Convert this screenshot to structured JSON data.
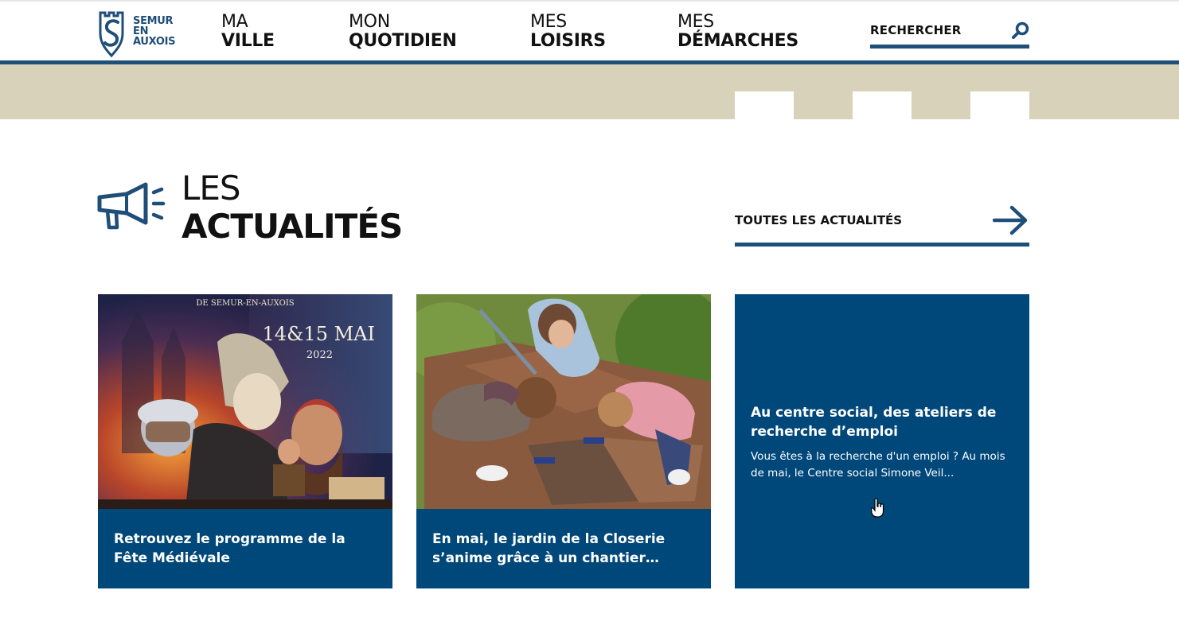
{
  "logo": {
    "line1": "SEMUR",
    "line2": "EN",
    "line3": "AUXOIS",
    "icon": "castle-shield-icon"
  },
  "nav": [
    {
      "top": "MA",
      "bottom": "VILLE"
    },
    {
      "top": "MON",
      "bottom": "QUOTIDIEN"
    },
    {
      "top": "MES",
      "bottom": "LOISIRS"
    },
    {
      "top": "MES",
      "bottom": "DÉMARCHES"
    }
  ],
  "search": {
    "label": "RECHERCHER",
    "icon": "search-icon"
  },
  "news": {
    "title_line1": "LES",
    "title_line2": "ACTUALITÉS",
    "icon": "megaphone-icon",
    "all_link": "TOUTES LES ACTUALITÉS",
    "all_link_icon": "arrow-right-icon",
    "cards": [
      {
        "title": "Retrouvez le programme de la Fête Médiévale",
        "image": {
          "icon": "medieval-festival-poster-image",
          "text_line1": "DE SEMUR-EN-AUXOIS",
          "text_line2": "14&15 MAI",
          "text_line3": "2022"
        }
      },
      {
        "title": "En mai, le jardin de la Closerie s’anime grâce à un chantier…",
        "image": {
          "icon": "garden-children-photo"
        }
      },
      {
        "title": "Au centre social, des ateliers de recherche d’emploi",
        "excerpt": "Vous êtes à la recherche d'un emploi ? Au mois de mai, le Centre social Simone Veil..."
      }
    ]
  },
  "colors": {
    "primary": "#1f4e79",
    "card_bg": "#00477a",
    "band": "#d9d2bb"
  }
}
